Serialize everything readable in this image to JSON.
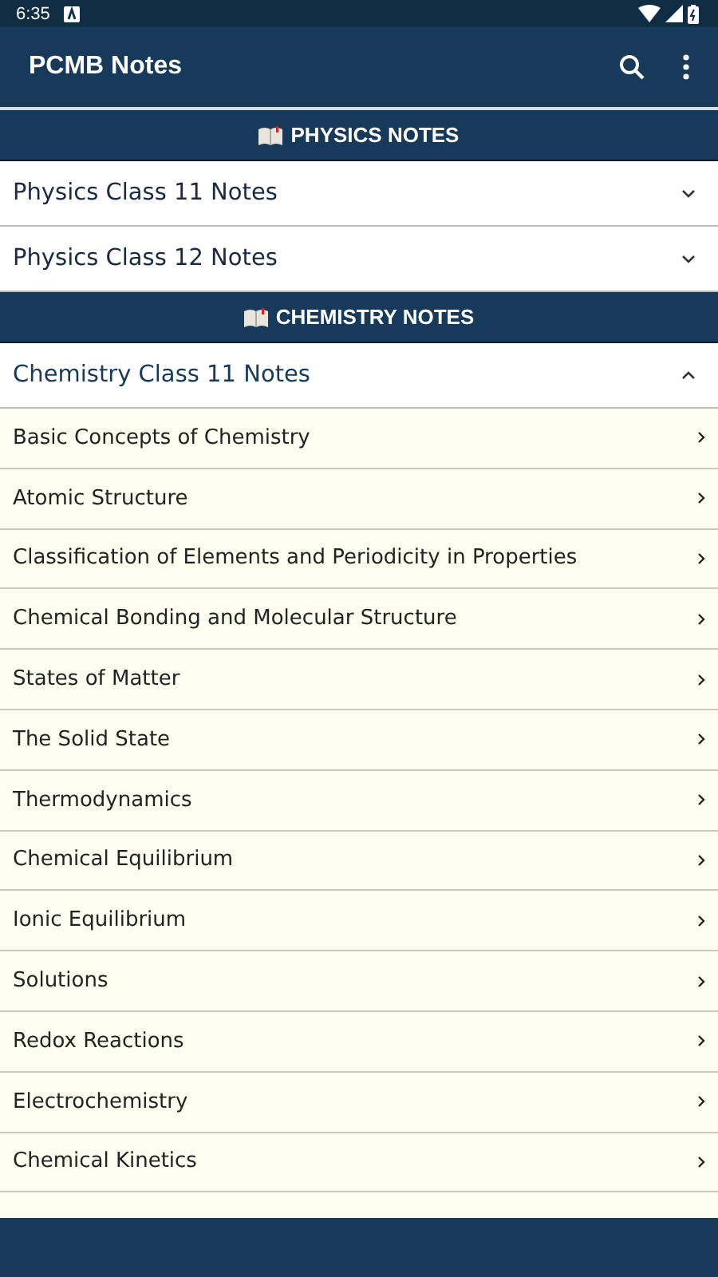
{
  "status_bar": {
    "time": "6:35"
  },
  "app_bar": {
    "title": "PCMB Notes"
  },
  "sections": [
    {
      "title": "PHYSICS NOTES",
      "groups": [
        {
          "title": "Physics Class 11 Notes",
          "expanded": false
        },
        {
          "title": "Physics Class 12 Notes",
          "expanded": false
        }
      ]
    },
    {
      "title": "CHEMISTRY NOTES",
      "groups": [
        {
          "title": "Chemistry Class 11 Notes",
          "expanded": true,
          "items": [
            "Basic Concepts of Chemistry",
            "Atomic Structure",
            "Classification of Elements and Periodicity in Properties",
            "Chemical Bonding and Molecular Structure",
            "States of Matter",
            "The Solid State",
            "Thermodynamics",
            "Chemical Equilibrium",
            "Ionic Equilibrium",
            "Solutions",
            "Redox Reactions",
            "Electrochemistry",
            "Chemical Kinetics"
          ]
        }
      ]
    }
  ]
}
